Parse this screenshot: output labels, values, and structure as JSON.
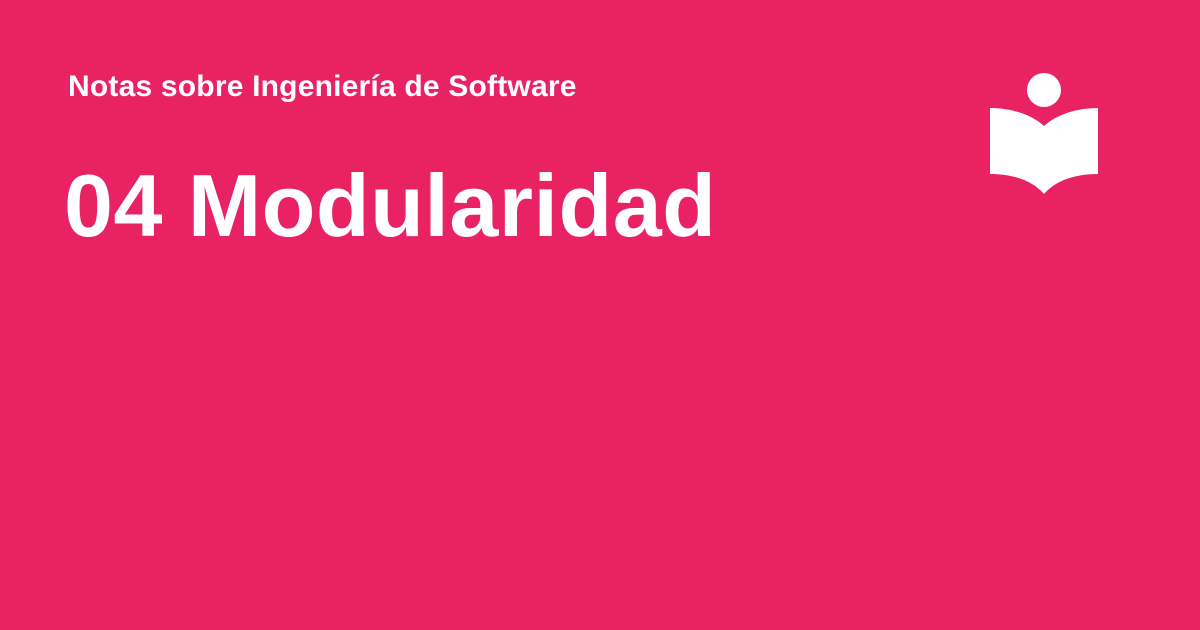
{
  "header": {
    "series_title": "Notas sobre Ingeniería de Software",
    "chapter_title": "04 Modularidad"
  },
  "logo": {
    "icon": "reader-book-icon"
  },
  "colors": {
    "background": "#e92264",
    "foreground": "#ffffff"
  }
}
